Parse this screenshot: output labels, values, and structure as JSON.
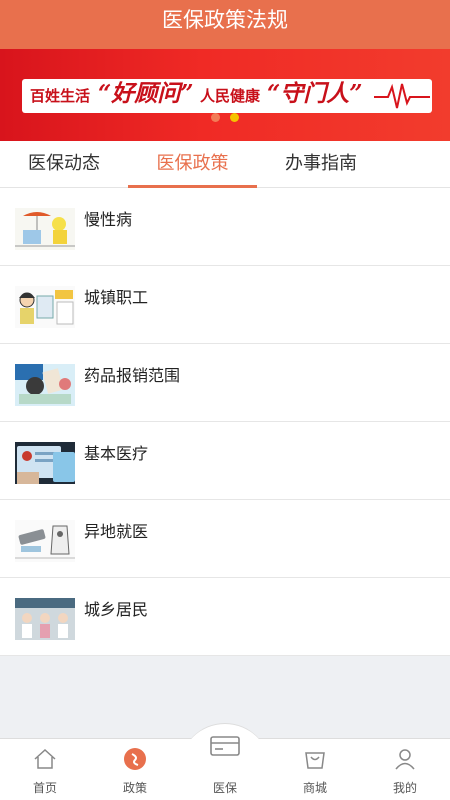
{
  "header": {
    "title": "医保政策法规"
  },
  "banner": {
    "part1": "百姓生活",
    "part2": "“好顾问”",
    "part3": "人民健康",
    "part4": "“守门人”",
    "dots": 2,
    "active_dot": 1
  },
  "tabs": [
    {
      "label": "医保动态",
      "active": false
    },
    {
      "label": "医保政策",
      "active": true
    },
    {
      "label": "办事指南",
      "active": false
    }
  ],
  "list": [
    {
      "label": "慢性病",
      "icon": "chronic-illness-thumbnail"
    },
    {
      "label": "城镇职工",
      "icon": "urban-employee-thumbnail"
    },
    {
      "label": "药品报销范围",
      "icon": "drug-reimbursement-thumbnail"
    },
    {
      "label": "基本医疗",
      "icon": "medical-card-thumbnail"
    },
    {
      "label": "异地就医",
      "icon": "remote-medical-thumbnail"
    },
    {
      "label": "城乡居民",
      "icon": "urban-rural-residents-thumbnail"
    }
  ],
  "tabbar": {
    "home": "首页",
    "policy": "政策",
    "insurance": "医保",
    "mall": "商城",
    "mine": "我的"
  },
  "colors": {
    "accent": "#e8704d",
    "banner_red": "#e01c22"
  }
}
